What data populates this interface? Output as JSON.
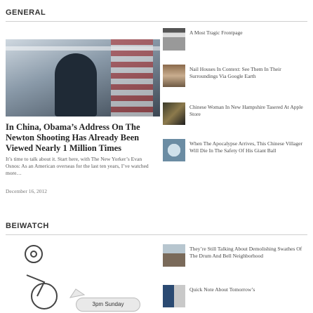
{
  "section_general": {
    "title": "GENERAL"
  },
  "feature": {
    "headline": "In China, Obama’s Address On The Newton Shooting Has Already Been Viewed Nearly 1 Million Times",
    "teaser": "It’s time to talk about it. Start here, with The New Yorker’s Evan Osnos: As an American overseas for the last ten years, I’ve watched more…",
    "date": "December 16, 2012"
  },
  "side_items": [
    {
      "text": "A Most Tragic Frontpage",
      "thumb_icon": "newspaper-thumb"
    },
    {
      "text": "Nail Houses In Context: See Them In Their Surroundings Via Google Earth",
      "thumb_icon": "house-thumb"
    },
    {
      "text": "Chinese Woman In New Hampshire Tasered At Apple Store",
      "thumb_icon": "store-thumb"
    },
    {
      "text": "When The Apocalypse Arrives, This Chinese Villager Will Die In The Safety Of His Giant Ball",
      "thumb_icon": "ball-thumb"
    }
  ],
  "section_beiwatch": {
    "title": "BEIWATCH"
  },
  "beiwatch": {
    "bubble_text": "3pm Sunday",
    "items": [
      {
        "text": "They’re Still Talking About Demolishing Swathes Of The Drum And Bell Neighborhood",
        "thumb_icon": "rooftops-thumb"
      },
      {
        "text": "Quick Note About Tomorrow’s",
        "thumb_icon": "sign-thumb"
      }
    ]
  }
}
